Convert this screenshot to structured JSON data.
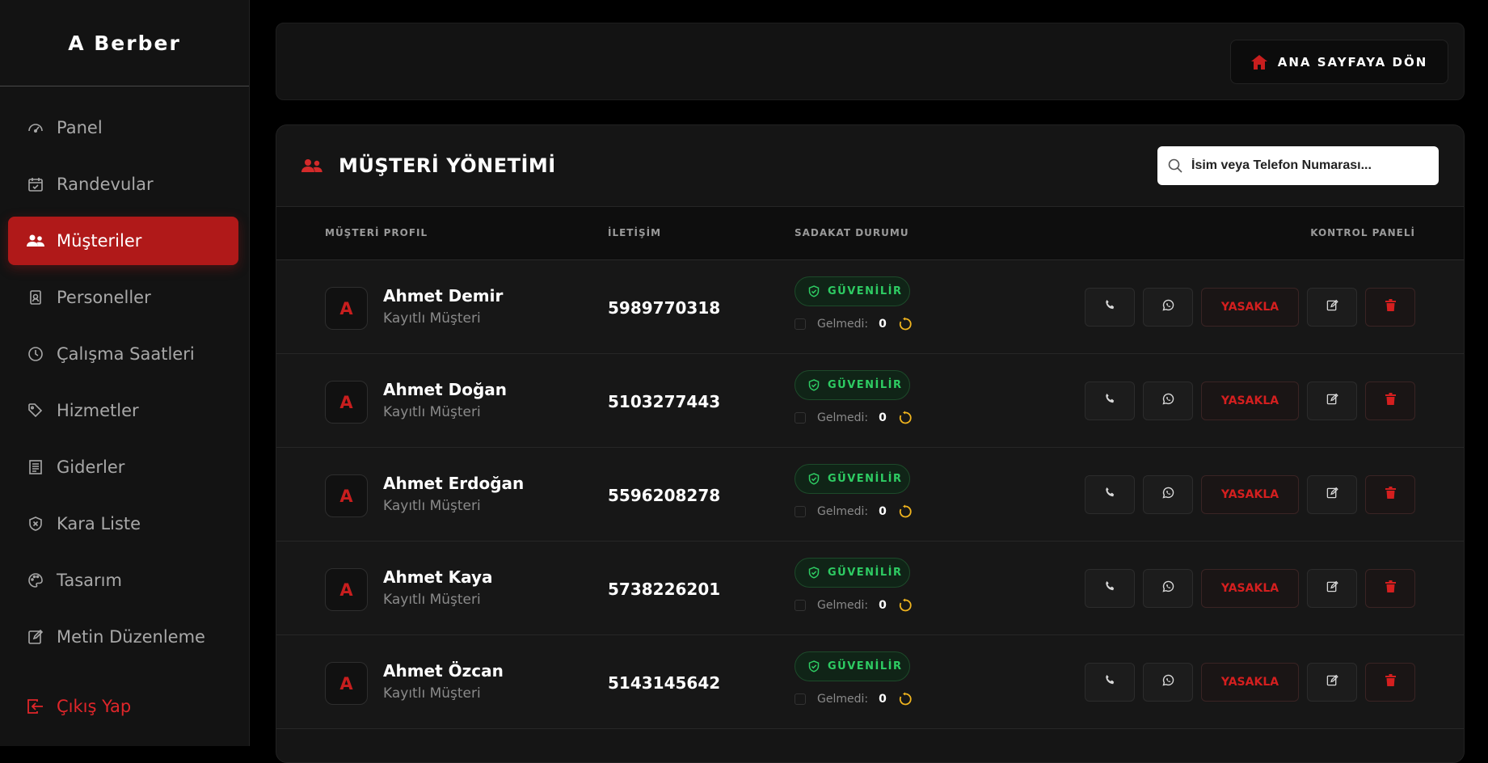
{
  "sidebar": {
    "brand": "A Berber",
    "items": [
      {
        "label": "Panel",
        "icon": "gauge-icon"
      },
      {
        "label": "Randevular",
        "icon": "calendar-check-icon"
      },
      {
        "label": "Müşteriler",
        "icon": "users-icon",
        "active": true
      },
      {
        "label": "Personeller",
        "icon": "id-badge-icon"
      },
      {
        "label": "Çalışma Saatleri",
        "icon": "clock-icon"
      },
      {
        "label": "Hizmetler",
        "icon": "tags-icon"
      },
      {
        "label": "Giderler",
        "icon": "receipt-icon"
      },
      {
        "label": "Kara Liste",
        "icon": "shield-x-icon"
      },
      {
        "label": "Tasarım",
        "icon": "palette-icon"
      },
      {
        "label": "Metin Düzenleme",
        "icon": "edit-icon"
      }
    ],
    "logout": "Çıkış Yap"
  },
  "topbar": {
    "home_button": "ANA SAYFAYA DÖN"
  },
  "panel": {
    "title": "MÜŞTERİ YÖNETİMİ",
    "search_placeholder": "İsim veya Telefon Numarası...",
    "columns": [
      "MÜŞTERİ PROFIL",
      "İLETİŞİM",
      "SADAKAT DURUMU",
      "KONTROL PANELİ"
    ]
  },
  "customers": [
    {
      "initial": "A",
      "name": "Ahmet Demir",
      "subtitle": "Kayıtlı Müşteri",
      "phone": "5989770318",
      "status": "GÜVENİLİR",
      "no_show_label": "Gelmedi:",
      "no_show": "0",
      "ban_label": "YASAKLA"
    },
    {
      "initial": "A",
      "name": "Ahmet Doğan",
      "subtitle": "Kayıtlı Müşteri",
      "phone": "5103277443",
      "status": "GÜVENİLİR",
      "no_show_label": "Gelmedi:",
      "no_show": "0",
      "ban_label": "YASAKLA"
    },
    {
      "initial": "A",
      "name": "Ahmet Erdoğan",
      "subtitle": "Kayıtlı Müşteri",
      "phone": "5596208278",
      "status": "GÜVENİLİR",
      "no_show_label": "Gelmedi:",
      "no_show": "0",
      "ban_label": "YASAKLA"
    },
    {
      "initial": "A",
      "name": "Ahmet Kaya",
      "subtitle": "Kayıtlı Müşteri",
      "phone": "5738226201",
      "status": "GÜVENİLİR",
      "no_show_label": "Gelmedi:",
      "no_show": "0",
      "ban_label": "YASAKLA"
    },
    {
      "initial": "A",
      "name": "Ahmet Özcan",
      "subtitle": "Kayıtlı Müşteri",
      "phone": "5143145642",
      "status": "GÜVENİLİR",
      "no_show_label": "Gelmedi:",
      "no_show": "0",
      "ban_label": "YASAKLA"
    }
  ],
  "colors": {
    "accent": "#b01919",
    "danger": "#d41f1f",
    "success": "#2ecc63",
    "warning": "#f0b41e"
  }
}
